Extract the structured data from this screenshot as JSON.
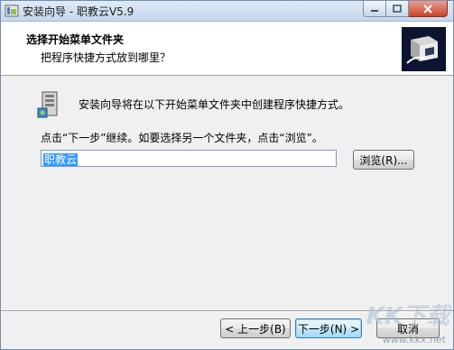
{
  "window": {
    "title": "安装向导 - 职教云V5.9"
  },
  "header": {
    "title": "选择开始菜单文件夹",
    "subtitle": "把程序快捷方式放到哪里？"
  },
  "body": {
    "intro": "安装向导将在以下开始菜单文件夹中创建程序快捷方式。",
    "hint": "点击“下一步”继续。如要选择另一个文件夹，点击“浏览”。",
    "folder_value": "职教云",
    "browse_label": "浏览(R)..."
  },
  "footer": {
    "back_label": "< 上一步(B)",
    "next_label": "下一步(N) >",
    "cancel_label": "取消"
  },
  "watermark": {
    "text": "KK下载",
    "url": "www.kkx.net"
  },
  "colors": {
    "title_bar": "#c5d7ec",
    "close_button": "#c7432c",
    "selection": "#3399ff",
    "logo_bg": "#0b1430"
  }
}
